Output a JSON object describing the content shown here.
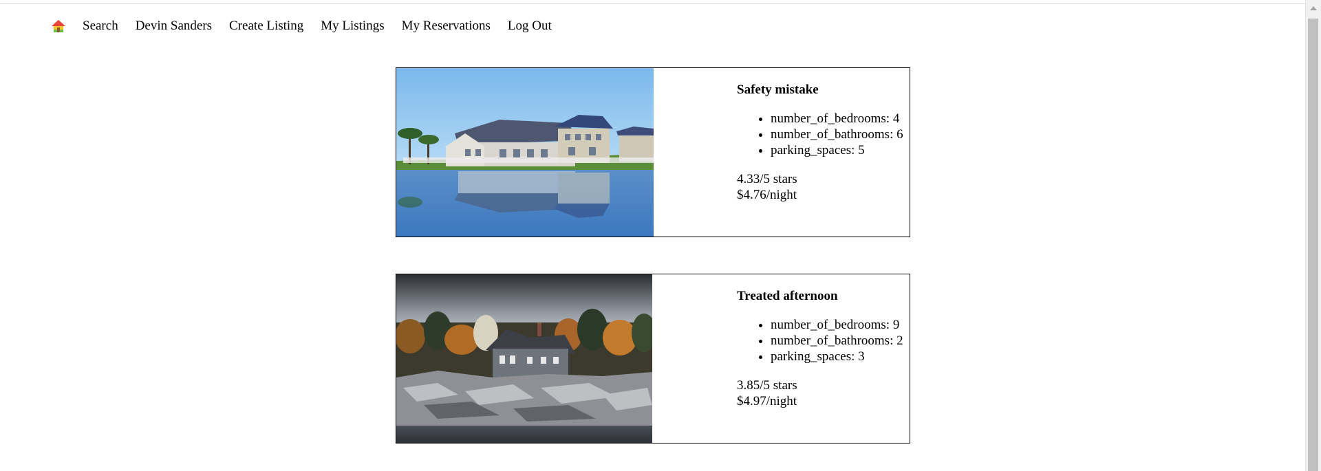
{
  "nav": {
    "home_icon": "home-icon",
    "links": {
      "search": "Search",
      "user": "Devin Sanders",
      "create_listing": "Create Listing",
      "my_listings": "My Listings",
      "my_reservations": "My Reservations",
      "log_out": "Log Out"
    }
  },
  "listings": [
    {
      "title": "Safety mistake",
      "features": [
        "number_of_bedrooms: 4",
        "number_of_bathrooms: 6",
        "parking_spaces: 5"
      ],
      "rating": "4.33/5 stars",
      "price": "$4.76/night"
    },
    {
      "title": "Treated afternoon",
      "features": [
        "number_of_bedrooms: 9",
        "number_of_bathrooms: 2",
        "parking_spaces: 3"
      ],
      "rating": "3.85/5 stars",
      "price": "$4.97/night"
    }
  ]
}
